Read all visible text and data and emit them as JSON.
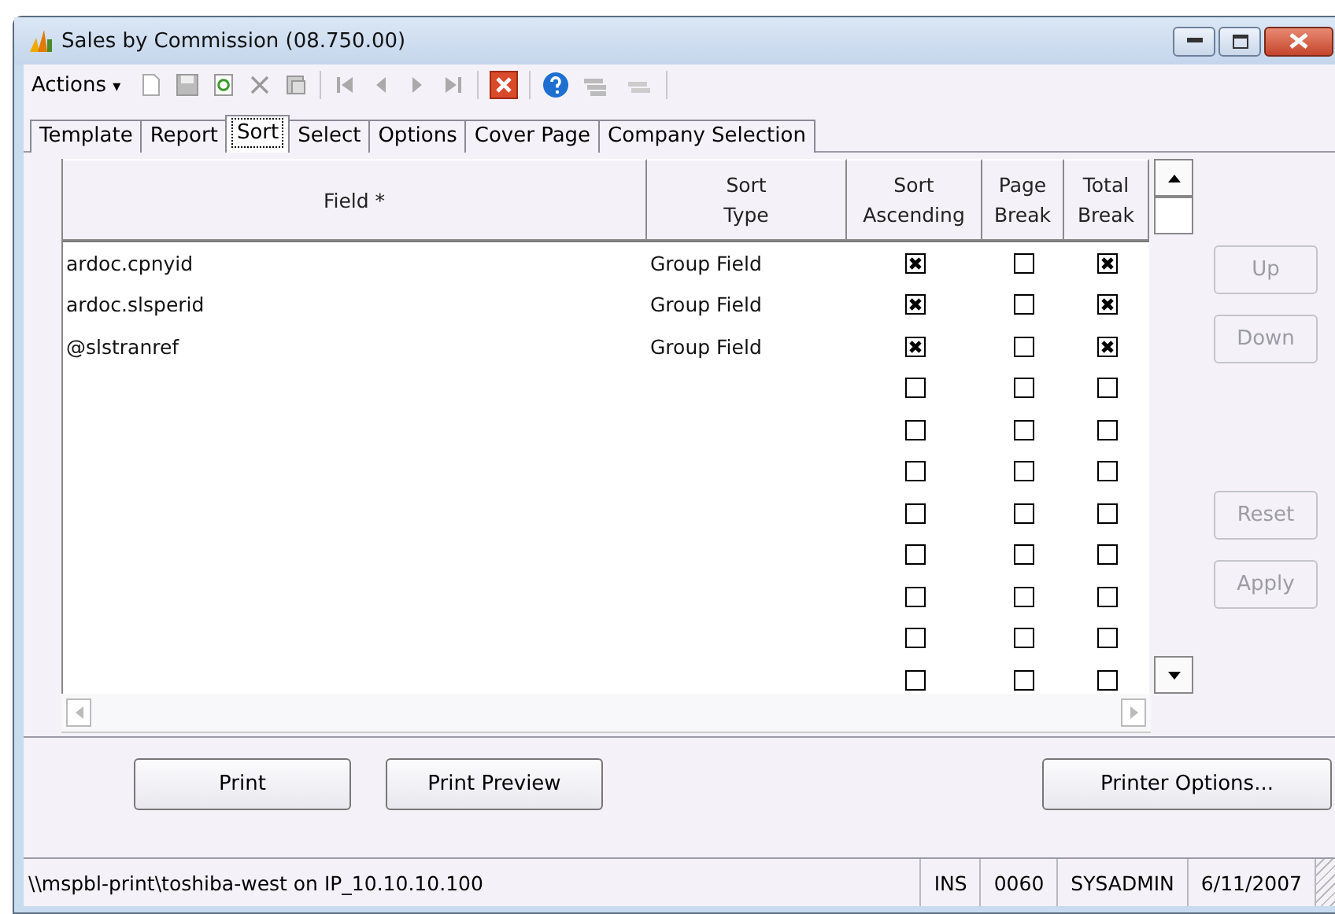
{
  "window": {
    "title": "Sales by Commission (08.750.00)"
  },
  "toolbar": {
    "menu": "Actions",
    "menu_caret": "▾"
  },
  "tabs": [
    {
      "label": "Template",
      "selected": false
    },
    {
      "label": "Report",
      "selected": false
    },
    {
      "label": "Sort",
      "selected": true
    },
    {
      "label": "Select",
      "selected": false
    },
    {
      "label": "Options",
      "selected": false
    },
    {
      "label": "Cover Page",
      "selected": false
    },
    {
      "label": "Company Selection",
      "selected": false
    }
  ],
  "table": {
    "columns": [
      "Field *",
      "Sort\nType",
      "Sort\nAscending",
      "Page\nBreak",
      "Total\nBreak"
    ],
    "rows": [
      {
        "field": "ardoc.cpnyid",
        "sort_type": "Group Field",
        "sort_ascending": true,
        "page_break": false,
        "total_break": true
      },
      {
        "field": "ardoc.slsperid",
        "sort_type": "Group Field",
        "sort_ascending": true,
        "page_break": false,
        "total_break": true
      },
      {
        "field": "@slstranref",
        "sort_type": "Group Field",
        "sort_ascending": true,
        "page_break": false,
        "total_break": true
      },
      {
        "sort_ascending": false,
        "page_break": false,
        "total_break": false
      },
      {
        "sort_ascending": false,
        "page_break": false,
        "total_break": false
      },
      {
        "sort_ascending": false,
        "page_break": false,
        "total_break": false
      },
      {
        "sort_ascending": false,
        "page_break": false,
        "total_break": false
      },
      {
        "sort_ascending": false,
        "page_break": false,
        "total_break": false
      },
      {
        "sort_ascending": false,
        "page_break": false,
        "total_break": false
      },
      {
        "sort_ascending": false,
        "page_break": false,
        "total_break": false
      },
      {
        "sort_ascending": false,
        "page_break": false,
        "total_break": false
      }
    ]
  },
  "side_buttons": [
    {
      "label": "Up",
      "disabled": true
    },
    {
      "label": "Down",
      "disabled": true
    },
    {
      "label": "Reset",
      "disabled": true
    },
    {
      "label": "Apply",
      "disabled": true
    }
  ],
  "buttons": [
    {
      "label": "Print",
      "kind": "left"
    },
    {
      "label": "Print Preview",
      "kind": "left"
    },
    {
      "label": "Printer Options...",
      "kind": "right"
    }
  ],
  "status_bar": {
    "printer": "\\\\mspbl-print\\toshiba-west on IP_10.10.10.100",
    "mode": "INS",
    "company": "0060",
    "user": "SYSADMIN",
    "date": "6/11/2007"
  }
}
